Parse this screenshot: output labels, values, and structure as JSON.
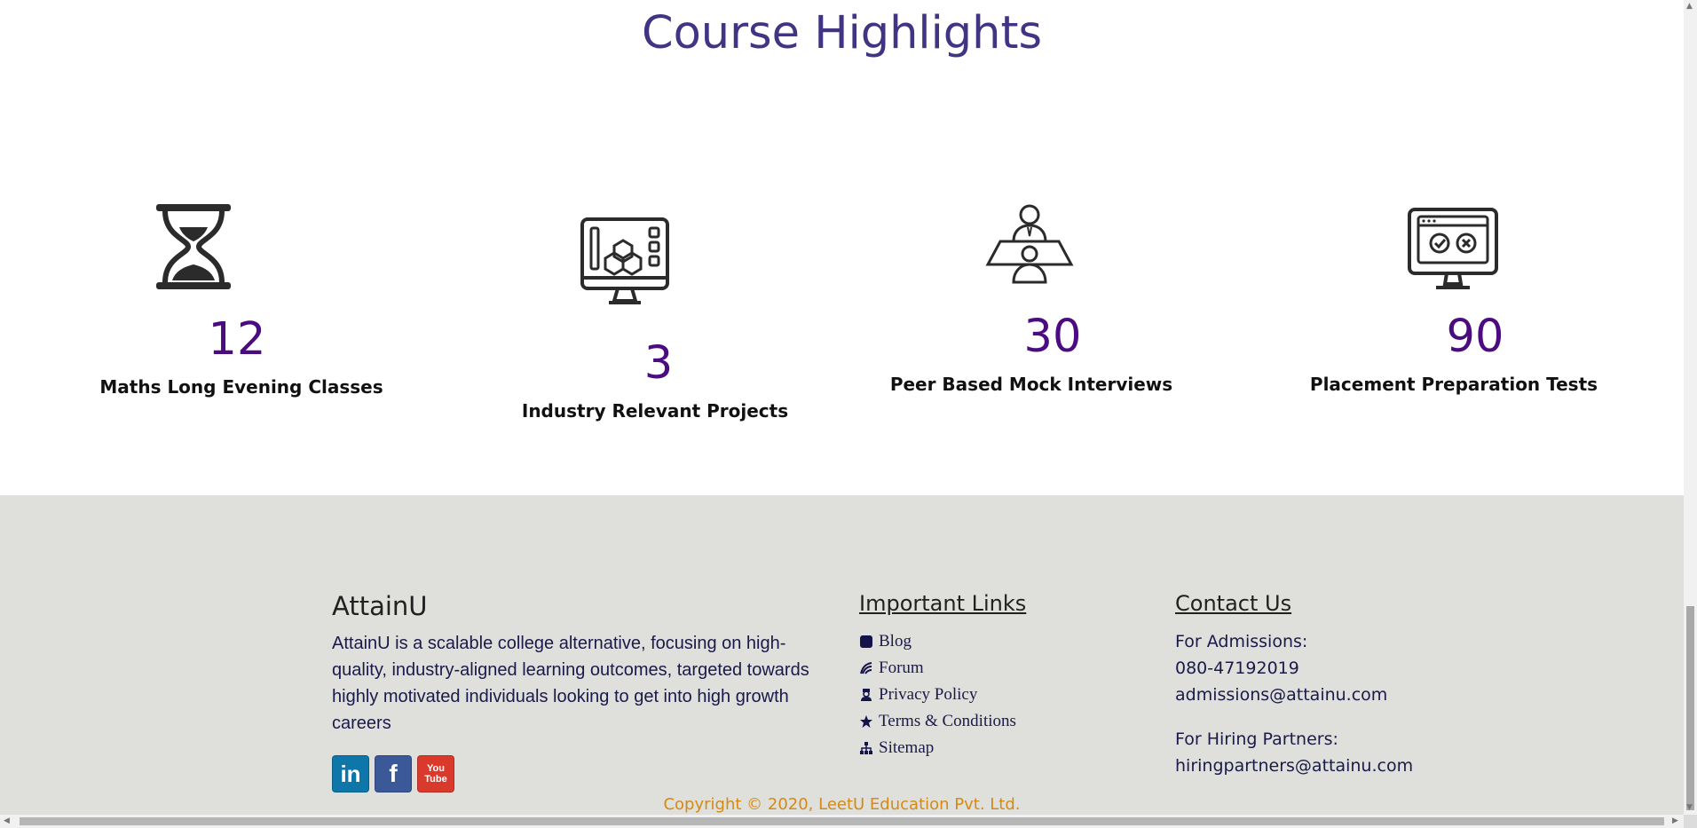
{
  "header": {
    "title": "Course Highlights"
  },
  "highlights": [
    {
      "icon": "hourglass-icon",
      "number": "12",
      "label": "Maths Long Evening Classes"
    },
    {
      "icon": "computer-cubes-icon",
      "number": "3",
      "label": "Industry Relevant Projects"
    },
    {
      "icon": "interview-icon",
      "number": "30",
      "label": "Peer Based Mock Interviews"
    },
    {
      "icon": "test-window-icon",
      "number": "90",
      "label": "Placement Preparation Tests"
    }
  ],
  "footer": {
    "brand": "AttainU",
    "about": "AttainU is a scalable college alternative, focusing on high-quality, industry-aligned learning outcomes, targeted towards highly motivated individuals looking to get into high growth careers",
    "socials": [
      {
        "name": "linkedin",
        "label": "in",
        "color": "#0e76a8"
      },
      {
        "name": "facebook",
        "label": "f",
        "color": "#3b5998"
      },
      {
        "name": "youtube",
        "label": "You Tube",
        "color": "#d93a2b"
      }
    ],
    "links_title": "Important Links",
    "links": [
      "Blog",
      "Forum",
      "Privacy Policy",
      "Terms & Conditions",
      "Sitemap"
    ],
    "contact_title": "Contact Us",
    "contact": {
      "admissions_label": "For Admissions:",
      "admissions_phone": "080-47192019",
      "admissions_email": "admissions@attainu.com",
      "hiring_label": "For Hiring Partners:",
      "hiring_email": "hiringpartners@attainu.com"
    },
    "copyright": "Copyright © 2020, LeetU Education Pvt. Ltd."
  },
  "colors": {
    "title": "#3f3582",
    "numbers": "#4a0c80",
    "footer_bg": "#dfdfdb",
    "copyright": "#d48a14"
  }
}
